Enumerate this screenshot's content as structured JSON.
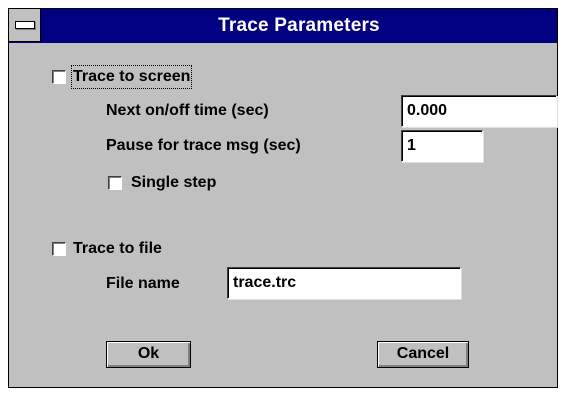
{
  "window": {
    "title": "Trace Parameters"
  },
  "trace_screen": {
    "label": "Trace to screen",
    "checked": false,
    "next_label": "Next on/off time (sec)",
    "next_value": "0.000",
    "pause_label": "Pause for trace msg (sec)",
    "pause_value": "1",
    "single_step_label": "Single step",
    "single_step_checked": false
  },
  "trace_file": {
    "label": "Trace to file",
    "checked": false,
    "file_name_label": "File name",
    "file_name_value": "trace.trc"
  },
  "buttons": {
    "ok": "Ok",
    "cancel": "Cancel"
  }
}
